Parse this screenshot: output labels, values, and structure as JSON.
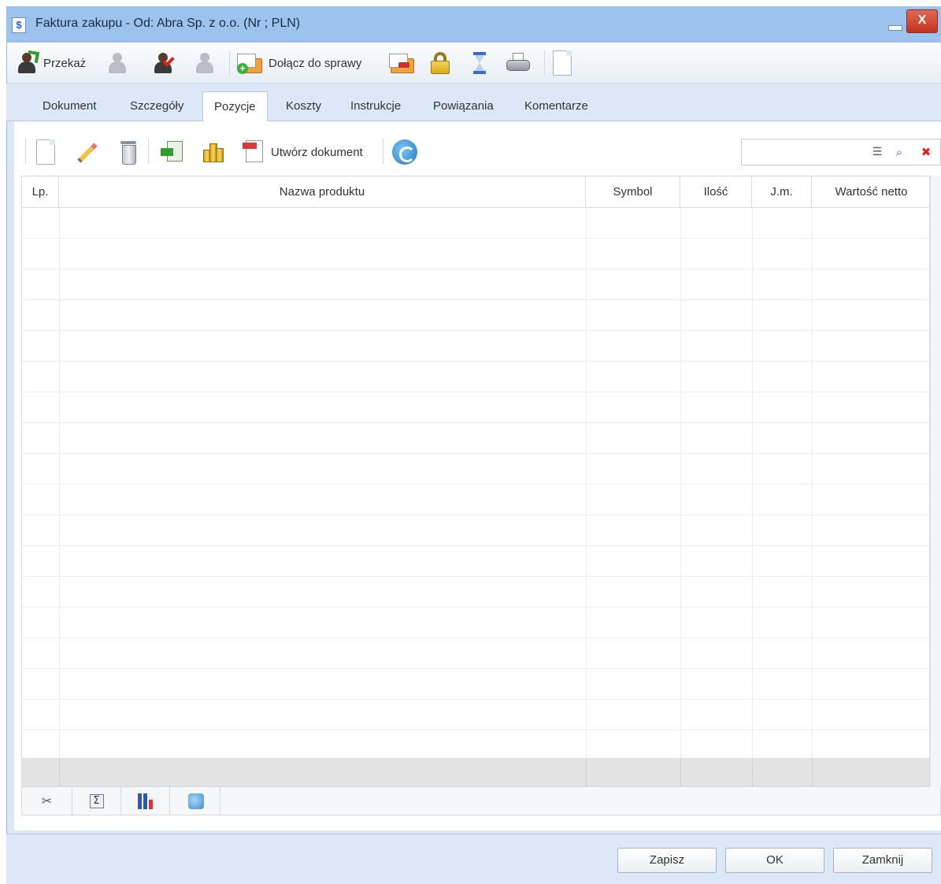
{
  "window": {
    "title": "Faktura zakupu - Od: Abra Sp. z o.o. (Nr ; PLN)",
    "app_icon": "invoice-dollar-icon",
    "close_glyph": "X"
  },
  "toolbar": {
    "przekaz_label": "Przekaż",
    "dolacz_label": "Dołącz do sprawy"
  },
  "tabs": [
    {
      "label": "Dokument"
    },
    {
      "label": "Szczegóły"
    },
    {
      "label": "Pozycje",
      "active": true
    },
    {
      "label": "Koszty"
    },
    {
      "label": "Instrukcje"
    },
    {
      "label": "Powiązania"
    },
    {
      "label": "Komentarze"
    }
  ],
  "panel_toolbar": {
    "utworz_label": "Utwórz dokument"
  },
  "search": {
    "value": "",
    "placeholder": ""
  },
  "grid": {
    "columns": [
      {
        "label": "Lp."
      },
      {
        "label": "Nazwa produktu"
      },
      {
        "label": "Symbol"
      },
      {
        "label": "Ilość"
      },
      {
        "label": "J.m."
      },
      {
        "label": "Wartość netto"
      }
    ],
    "rows": []
  },
  "footer": {
    "zapisz": "Zapisz",
    "ok": "OK",
    "zamknij": "Zamknij"
  },
  "colors": {
    "titlebar": "#9bc3ee",
    "window_bg": "#dce8f7",
    "close_button": "#c4331f"
  }
}
